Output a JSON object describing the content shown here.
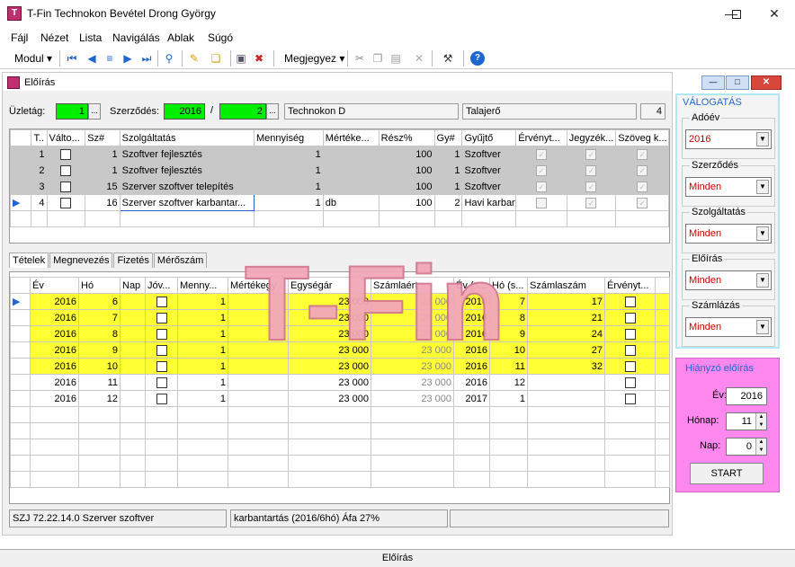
{
  "window": {
    "title": "T-Fin Technokon Bevétel Drong György",
    "app_icon_text": "T"
  },
  "menu": [
    "Fájl",
    "Nézet",
    "Lista",
    "Navigálás",
    "Ablak",
    "Súgó"
  ],
  "toolbar": {
    "modul_label": "Modul",
    "megjegyez_label": "Megjegyez"
  },
  "child": {
    "title": "Előírás"
  },
  "header": {
    "uzletag_label": "Üzletág:",
    "uzletag_value": "1",
    "szerzodes_label": "Szerződés:",
    "szerzodes_year": "2016",
    "slash": "/",
    "szerzodes_num": "2",
    "partner": "Technokon D",
    "contact": "Talajerő",
    "count": "4"
  },
  "top_grid": {
    "columns": [
      "T..",
      "Válto...",
      "Sz#",
      "Szolgáltatás",
      "Mennyiség",
      "Mértéke...",
      "Rész%",
      "Gy#",
      "Gyűjtő",
      "Érvényt...",
      "Jegyzék...",
      "Szöveg k..."
    ],
    "rows": [
      {
        "t": "1",
        "sz": "1",
        "szolg": "Szoftver fejlesztés",
        "menny": "1",
        "mert": "",
        "resz": "100",
        "gy": "1",
        "gyujto": "Szoftver"
      },
      {
        "t": "2",
        "sz": "1",
        "szolg": "Szoftver fejlesztés",
        "menny": "1",
        "mert": "",
        "resz": "100",
        "gy": "1",
        "gyujto": "Szoftver"
      },
      {
        "t": "3",
        "sz": "15",
        "szolg": "Szerver szoftver telepítés",
        "menny": "1",
        "mert": "",
        "resz": "100",
        "gy": "1",
        "gyujto": "Szoftver"
      },
      {
        "t": "4",
        "sz": "16",
        "szolg": "Szerver szoftver karbantar...",
        "menny": "1",
        "mert": "db",
        "resz": "100",
        "gy": "2",
        "gyujto": "Havi karbantar..."
      }
    ]
  },
  "tabs": [
    "Tételek",
    "Megnevezés",
    "Fizetés",
    "Mérőszám"
  ],
  "bottom_grid": {
    "columns": [
      "Év",
      "Hó",
      "Nap",
      "Jóv...",
      "Menny...",
      "Mértékegy",
      "Egységár",
      "Számlaért",
      "Év (s...",
      "Hó (s...",
      "Számlaszám",
      "Érvényt..."
    ],
    "rows": [
      {
        "ev": "2016",
        "ho": "6",
        "egysegar": "23 000",
        "szamlaert": "23 000",
        "ev_s": "2016",
        "ho_s": "7",
        "szamlaszam": "17"
      },
      {
        "ev": "2016",
        "ho": "7",
        "egysegar": "23 000",
        "szamlaert": "23 000",
        "ev_s": "2016",
        "ho_s": "8",
        "szamlaszam": "21"
      },
      {
        "ev": "2016",
        "ho": "8",
        "egysegar": "23 000",
        "szamlaert": "23 000",
        "ev_s": "2016",
        "ho_s": "9",
        "szamlaszam": "24"
      },
      {
        "ev": "2016",
        "ho": "9",
        "egysegar": "23 000",
        "szamlaert": "23 000",
        "ev_s": "2016",
        "ho_s": "10",
        "szamlaszam": "27"
      },
      {
        "ev": "2016",
        "ho": "10",
        "egysegar": "23 000",
        "szamlaert": "23 000",
        "ev_s": "2016",
        "ho_s": "11",
        "szamlaszam": "32"
      },
      {
        "ev": "2016",
        "ho": "11",
        "egysegar": "23 000",
        "szamlaert": "23 000",
        "ev_s": "2016",
        "ho_s": "12",
        "szamlaszam": ""
      },
      {
        "ev": "2016",
        "ho": "12",
        "egysegar": "23 000",
        "szamlaert": "23 000",
        "ev_s": "2017",
        "ho_s": "1",
        "szamlaszam": ""
      }
    ],
    "menny": "1"
  },
  "status": {
    "left": "SZJ 72.22.14.0 Szerver szoftver",
    "mid": "karbantartás (2016/6hó) Áfa 27%",
    "right": ""
  },
  "valogatas": {
    "title": "VÁLOGATÁS",
    "groups": [
      {
        "label": "Adóév",
        "value": "2016"
      },
      {
        "label": "Szerződés",
        "value": "Minden"
      },
      {
        "label": "Szolgáltatás",
        "value": "Minden"
      },
      {
        "label": "Előírás",
        "value": "Minden"
      },
      {
        "label": "Számlázás",
        "value": "Minden"
      }
    ]
  },
  "hianyzo": {
    "title": "Hiányzó előírás",
    "ev_label": "Év:",
    "ev": "2016",
    "honap_label": "Hónap:",
    "honap": "11",
    "nap_label": "Nap:",
    "nap": "0",
    "start": "START"
  },
  "bottom_title": "Előírás",
  "watermark": "T-Fin",
  "colors": {
    "green_field": "#00ee00",
    "yellow_row": "#ffff33",
    "gray_row": "#c8c8c8",
    "pink_panel": "#ff88ee",
    "accent_blue": "#1e66d0"
  }
}
